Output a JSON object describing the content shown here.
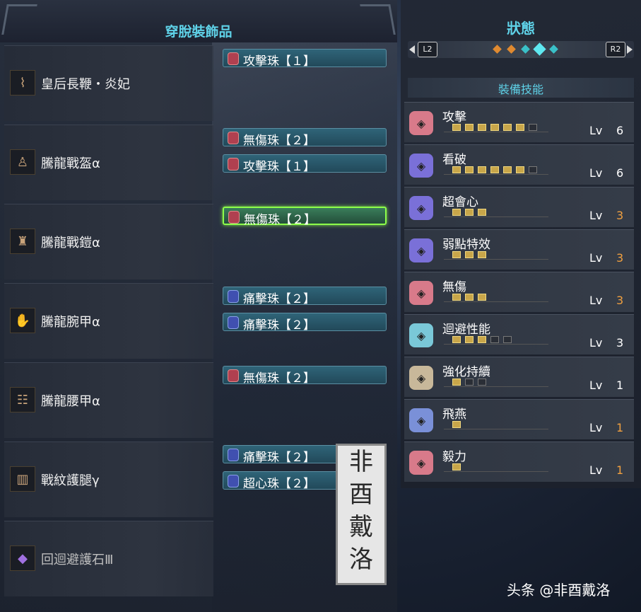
{
  "left_panel": {
    "title": "穿脫裝飾品",
    "equipment": [
      {
        "name": "皇后長鞭・炎妃",
        "icon": "whip-icon",
        "decorations": [
          "攻擊珠【１】"
        ]
      },
      {
        "name": "騰龍戰盔α",
        "icon": "helm-icon",
        "decorations": [
          "無傷珠【２】",
          "攻擊珠【１】"
        ]
      },
      {
        "name": "騰龍戰鎧α",
        "icon": "chest-armor-icon",
        "decorations": [
          "無傷珠【２】"
        ]
      },
      {
        "name": "騰龍腕甲α",
        "icon": "gauntlet-icon",
        "decorations": [
          "痛擊珠【２】",
          "痛擊珠【２】"
        ]
      },
      {
        "name": "騰龍腰甲α",
        "icon": "waist-armor-icon",
        "decorations": [
          "無傷珠【２】"
        ]
      },
      {
        "name": "戰紋護腿γ",
        "icon": "leg-armor-icon",
        "decorations": [
          "痛擊珠【２】",
          "超心珠【２】"
        ]
      },
      {
        "name": "回迴避護石Ⅲ",
        "icon": "charm-icon",
        "decorations": []
      }
    ],
    "selected_slot": "騰龍戰鎧α / 無傷珠【２】",
    "stamp_chars": [
      "非",
      "酉",
      "戴",
      "洛"
    ]
  },
  "right_panel": {
    "title": "狀態",
    "left_button": "L2",
    "right_button": "R2",
    "section_title": "裝備技能",
    "lv_label": "Lv",
    "skills": [
      {
        "name": "攻擊",
        "level": "6",
        "max": 7,
        "color": "#d87a8a",
        "lv_color": "white"
      },
      {
        "name": "看破",
        "level": "6",
        "max": 7,
        "color": "#7a70d8",
        "lv_color": "white"
      },
      {
        "name": "超會心",
        "level": "3",
        "max": 3,
        "color": "#7a70d8",
        "lv_color": "orange"
      },
      {
        "name": "弱點特效",
        "level": "3",
        "max": 3,
        "color": "#7a70d8",
        "lv_color": "orange"
      },
      {
        "name": "無傷",
        "level": "3",
        "max": 3,
        "color": "#d87a8a",
        "lv_color": "orange"
      },
      {
        "name": "迴避性能",
        "level": "3",
        "max": 5,
        "color": "#7ac8d8",
        "lv_color": "white"
      },
      {
        "name": "強化持續",
        "level": "1",
        "max": 3,
        "color": "#c8b89a",
        "lv_color": "white"
      },
      {
        "name": "飛燕",
        "level": "1",
        "max": 1,
        "color": "#7a90d8",
        "lv_color": "orange"
      },
      {
        "name": "毅力",
        "level": "1",
        "max": 1,
        "color": "#d87a8a",
        "lv_color": "orange"
      }
    ]
  },
  "watermark": "头条 @非酉戴洛"
}
